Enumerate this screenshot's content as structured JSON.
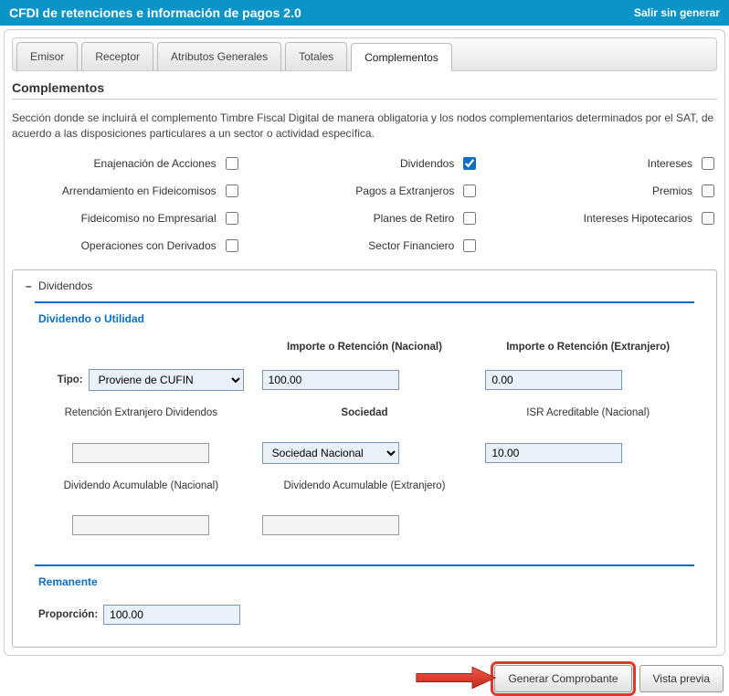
{
  "header": {
    "title": "CFDI de retenciones e información de pagos 2.0",
    "exit": "Salir sin generar"
  },
  "tabs": {
    "items": [
      {
        "label": "Emisor"
      },
      {
        "label": "Receptor"
      },
      {
        "label": "Atributos Generales"
      },
      {
        "label": "Totales"
      },
      {
        "label": "Complementos"
      }
    ]
  },
  "section": {
    "title": "Complementos",
    "description": "Sección donde se incluirá el complemento Timbre Fiscal Digital de manera obligatoria y los nodos complementarios determinados por el SAT, de acuerdo a las disposiciones particulares a un sector o actividad específica."
  },
  "checks": {
    "enajenacion": "Enajenación de Acciones",
    "arrendamiento": "Arrendamiento en Fideicomisos",
    "fideicomiso": "Fideicomiso no Empresarial",
    "operaciones": "Operaciones con Derivados",
    "dividendos": "Dividendos",
    "pagos_extranjeros": "Pagos a Extranjeros",
    "planes": "Planes de Retiro",
    "sector": "Sector Financiero",
    "intereses": "Intereses",
    "premios": "Premios",
    "hipotecarios": "Intereses Hipotecarios"
  },
  "dividendos": {
    "group_label": "Dividendos",
    "sub1_title": "Dividendo o Utilidad",
    "headers": {
      "col1_tipo": "Tipo:",
      "col2": "Importe o Retención (Nacional)",
      "col3": "Importe o Retención (Extranjero)"
    },
    "row1": {
      "tipo_value": "Proviene de CUFIN",
      "nacional": "100.00",
      "extranjero": "0.00"
    },
    "labels2": {
      "ret_ext": "Retención Extranjero Dividendos",
      "sociedad": "Sociedad",
      "isr": "ISR Acreditable (Nacional)"
    },
    "row2": {
      "ret_ext": "",
      "sociedad_value": "Sociedad Nacional",
      "isr": "10.00"
    },
    "labels3": {
      "div_acum_nac": "Dividendo Acumulable (Nacional)",
      "div_acum_ext": "Dividendo Acumulable (Extranjero)"
    },
    "row3": {
      "nac": "",
      "ext": ""
    },
    "remanente_title": "Remanente",
    "proporcion_label": "Proporción:",
    "proporcion_value": "100.00"
  },
  "footer": {
    "generar": "Generar Comprobante",
    "vista": "Vista previa"
  }
}
